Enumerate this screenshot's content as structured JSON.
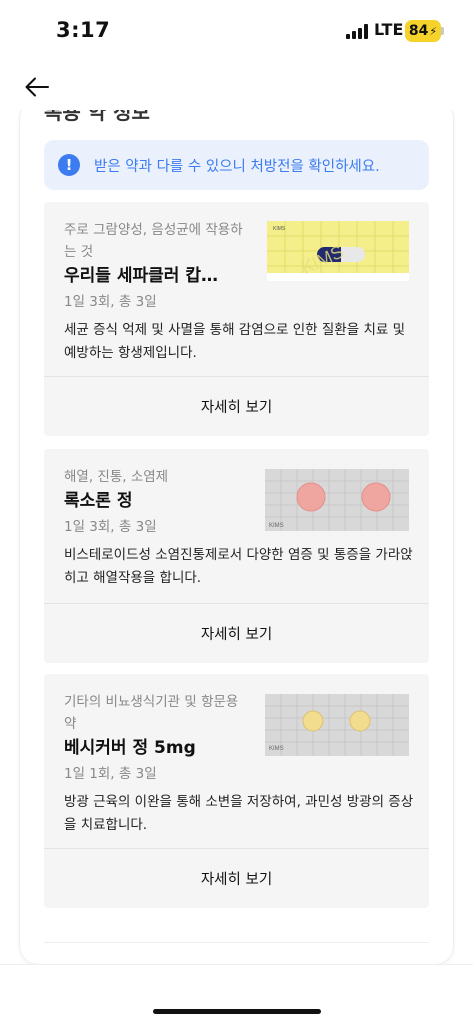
{
  "status_bar": {
    "time": "3:17",
    "network": "LTE",
    "battery": "84"
  },
  "nav": {
    "back_icon": "arrow-left-icon"
  },
  "section": {
    "heading_fragment": "복용 약 정보"
  },
  "notice": {
    "icon": "exclamation-circle-icon",
    "text": "받은 약과 다를 수 있으니 처방전을 확인하세요.",
    "accent_color": "#3c7cf0"
  },
  "medications": [
    {
      "category": "주로 그람양성, 음성균에 작용하는 것",
      "name": "우리들 세파클러 캅…",
      "dosage": "1일 3회, 총 3일",
      "description": "세균 증식 억제 및 사멸을 통해 감염으로 인한 질환을 치료 및 예방하는 항생제입니다.",
      "detail_label": "자세히 보기",
      "image": "capsule-photo"
    },
    {
      "category": "해열, 진통, 소염제",
      "name": "록소론 정",
      "dosage": "1일 3회, 총 3일",
      "description": "비스테로이드성 소염진통제로서 다양한 염증 및 통증을 가라앉히고 해열작용을 합니다.",
      "detail_label": "자세히 보기",
      "image": "pink-tablet-photo"
    },
    {
      "category": "기타의 비뇨생식기관 및 항문용약",
      "name": "베시커버 정 5mg",
      "dosage": "1일 1회, 총 3일",
      "description": "방광 근육의 이완을 통해 소변을 저장하여, 과민성 방광의 증상을 치료합니다.",
      "detail_label": "자세히 보기",
      "image": "yellow-tablet-photo"
    }
  ],
  "image_watermark": "KIMS"
}
